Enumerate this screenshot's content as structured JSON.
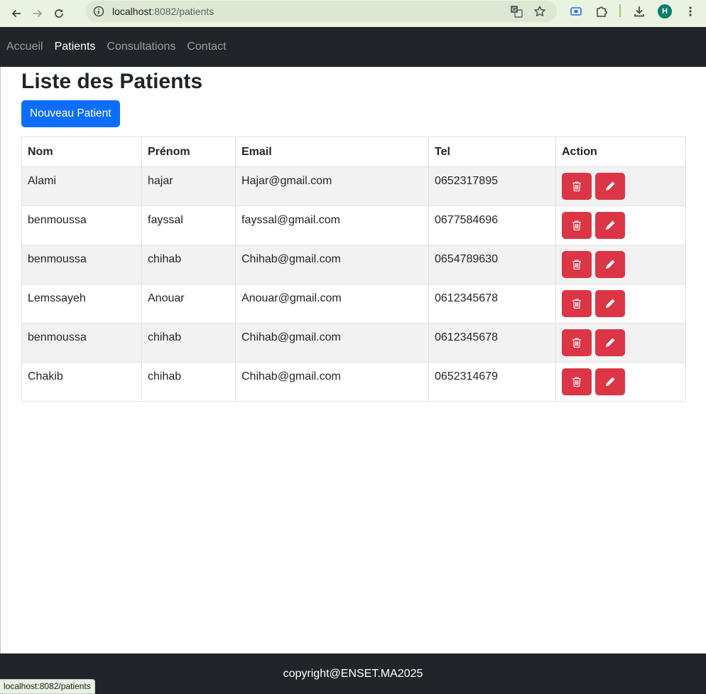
{
  "browser": {
    "url_host": "localhost",
    "url_path": ":8082/patients",
    "profile_initial": "H",
    "status_url": "localhost:8082/patients",
    "icons": [
      "back-arrow-icon",
      "forward-arrow-icon",
      "reload-icon",
      "site-info-icon",
      "translate-icon",
      "star-icon",
      "extension-icon",
      "puzzle-icon",
      "download-icon",
      "kebab-menu-icon"
    ]
  },
  "navbar": {
    "items": [
      {
        "label": "Accueil",
        "active": false
      },
      {
        "label": "Patients",
        "active": true
      },
      {
        "label": "Consultations",
        "active": false
      },
      {
        "label": "Contact",
        "active": false
      }
    ]
  },
  "page": {
    "title": "Liste des Patients",
    "new_button": "Nouveau Patient"
  },
  "table": {
    "headers": [
      "Nom",
      "Prénom",
      "Email",
      "Tel",
      "Action"
    ],
    "rows": [
      {
        "nom": "Alami",
        "prenom": "hajar",
        "email": "Hajar@gmail.com",
        "tel": "0652317895"
      },
      {
        "nom": "benmoussa",
        "prenom": "fayssal",
        "email": "fayssal@gmail.com",
        "tel": "0677584696"
      },
      {
        "nom": "benmoussa",
        "prenom": "chihab",
        "email": "Chihab@gmail.com",
        "tel": "0654789630"
      },
      {
        "nom": "Lemssayeh",
        "prenom": "Anouar",
        "email": "Anouar@gmail.com",
        "tel": "0612345678"
      },
      {
        "nom": "benmoussa",
        "prenom": "chihab",
        "email": "Chihab@gmail.com",
        "tel": "0612345678"
      },
      {
        "nom": "Chakib",
        "prenom": "chihab",
        "email": "Chihab@gmail.com",
        "tel": "0652314679"
      }
    ],
    "action_icons": [
      "trash-icon",
      "pencil-icon"
    ]
  },
  "footer": {
    "text": "copyright@ENSET.MA2025"
  },
  "colors": {
    "primary": "#0d6efd",
    "danger": "#dc3545",
    "dark": "#212529",
    "stripe": "#f2f2f2"
  }
}
